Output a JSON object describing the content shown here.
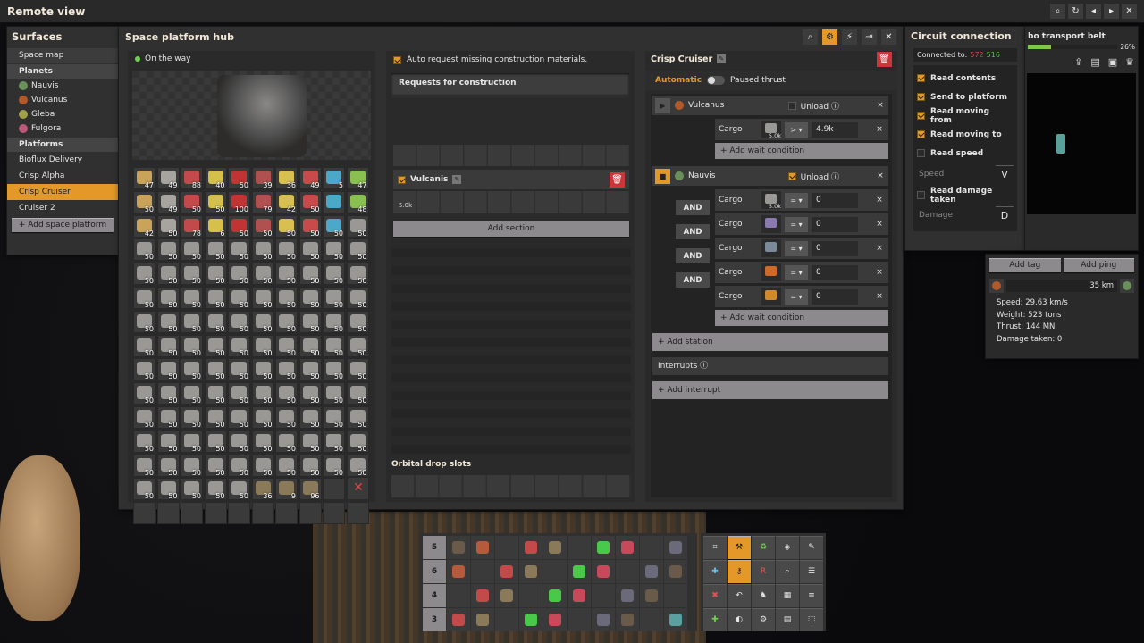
{
  "colors": {
    "accent": "#e39827",
    "danger": "#c8383a",
    "panel": "#313031"
  },
  "topbar": {
    "title": "Remote view",
    "icons": [
      "search-icon",
      "refresh-icon",
      "back-icon",
      "forward-icon",
      "close-icon"
    ]
  },
  "surfaces": {
    "title": "Surfaces",
    "space_map": "Space map",
    "planets_header": "Planets",
    "planets": [
      "Nauvis",
      "Vulcanus",
      "Gleba",
      "Fulgora"
    ],
    "platforms_header": "Platforms",
    "platforms": [
      "Bioflux Delivery",
      "Crisp Alpha",
      "Crisp Cruiser",
      "Cruiser 2"
    ],
    "add_platform": "+ Add space platform"
  },
  "hub": {
    "title": "Space platform hub",
    "status": "On the way",
    "inventory_counts": [
      "47",
      "49",
      "88",
      "40",
      "50",
      "39",
      "36",
      "49",
      "5",
      "47",
      "50",
      "49",
      "50",
      "50",
      "100",
      "79",
      "42",
      "50",
      "",
      "48",
      "42",
      "50",
      "78",
      "6",
      "50",
      "50",
      "50",
      "50",
      "50"
    ],
    "repeated_count": "50",
    "last_row": [
      "50",
      "50",
      "50",
      "50",
      "50",
      "36",
      "9",
      "96"
    ]
  },
  "construction": {
    "auto_request": "Auto request missing construction materials.",
    "requests_header": "Requests for construction",
    "section_name": "Vulcanis",
    "section_slot_count": "5.0k",
    "add_section": "Add section",
    "orbital_header": "Orbital drop slots"
  },
  "schedule": {
    "title": "Crisp Cruiser",
    "automatic": "Automatic",
    "paused": "Paused thrust",
    "stations": [
      {
        "name": "Vulcanus",
        "unload": "Unload",
        "unload_checked": false,
        "conditions": [
          {
            "label": "Cargo",
            "count": "5.0k",
            "op": ">",
            "value": "4.9k"
          }
        ]
      },
      {
        "name": "Nauvis",
        "unload": "Unload",
        "unload_checked": true,
        "conditions": [
          {
            "label": "Cargo",
            "count": "5.0k",
            "op": "=",
            "value": "0"
          },
          {
            "label": "Cargo",
            "count": "",
            "op": "=",
            "value": "0"
          },
          {
            "label": "Cargo",
            "count": "",
            "op": "=",
            "value": "0"
          },
          {
            "label": "Cargo",
            "count": "",
            "op": "=",
            "value": "0"
          },
          {
            "label": "Cargo",
            "count": "",
            "op": "=",
            "value": "0"
          }
        ]
      }
    ],
    "and": "AND",
    "add_wait": "+ Add wait condition",
    "add_station": "+ Add station",
    "interrupts": "Interrupts",
    "add_interrupt": "+ Add interrupt"
  },
  "circuit": {
    "title": "Circuit connection",
    "connected": "Connected to:",
    "red_count": "572",
    "green_count": "516",
    "options": [
      "Read contents",
      "Send to platform",
      "Read moving from",
      "Read moving to",
      "Read speed"
    ],
    "options_checked": [
      true,
      true,
      true,
      true,
      false
    ],
    "speed_label": "Speed",
    "speed_signal": "V",
    "damage_option": "Read damage taken",
    "damage_label": "Damage",
    "damage_signal": "D"
  },
  "info": {
    "belt_title": "bo transport belt",
    "belt_pct": "26%",
    "belt_progress": 0.26,
    "add_tag": "Add tag",
    "add_ping": "Add ping",
    "distance": "35 km",
    "speed": "Speed: 29.63 km/s",
    "weight": "Weight: 523 tons",
    "thrust": "Thrust: 144 MN",
    "damage": "Damage taken: 0"
  },
  "quickbar": {
    "rows": [
      "5",
      "6",
      "4",
      "3"
    ]
  }
}
